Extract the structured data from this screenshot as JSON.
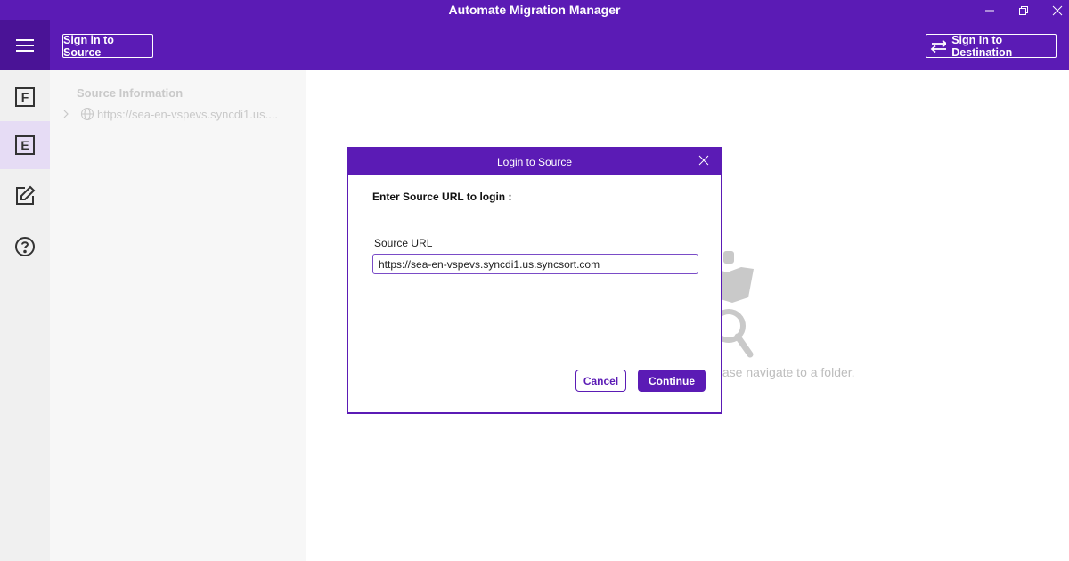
{
  "window": {
    "title": "Automate Migration Manager",
    "controls": {
      "minimize": "minimize-icon",
      "restore": "restore-icon",
      "close": "close-icon"
    }
  },
  "header": {
    "menu_icon": "hamburger-icon",
    "sign_in_source_label": "Sign in to Source",
    "sign_in_destination_label": "Sign In to Destination",
    "destination_icon": "swap-arrows-icon"
  },
  "nav_rail": {
    "items": [
      {
        "label": "F",
        "icon": "letter-f-icon",
        "active": false
      },
      {
        "label": "E",
        "icon": "letter-e-icon",
        "active": true
      },
      {
        "icon": "edit-icon",
        "active": false
      },
      {
        "icon": "help-icon",
        "active": false
      }
    ]
  },
  "source_panel": {
    "title": "Source Information",
    "tree": [
      {
        "label": "https://sea-en-vspevs.syncdi1.us....",
        "icon": "globe-icon",
        "expanded": false
      }
    ]
  },
  "empty_state": {
    "icon": "folder-search-icon",
    "message": "lease navigate to a folder."
  },
  "dialog": {
    "title": "Login to Source",
    "heading": "Enter Source URL to login :",
    "field_label": "Source URL",
    "url_value": "https://sea-en-vspevs.syncdi1.us.syncsort.com",
    "cancel_label": "Cancel",
    "continue_label": "Continue"
  },
  "colors": {
    "brand_purple": "#5b1bb5",
    "brand_purple_dark": "#4a1396",
    "active_rail_bg": "#e6dcf5",
    "rail_bg": "#f0f0f0",
    "panel_bg": "#f7f7f7",
    "muted_text": "#c9c9c9"
  }
}
